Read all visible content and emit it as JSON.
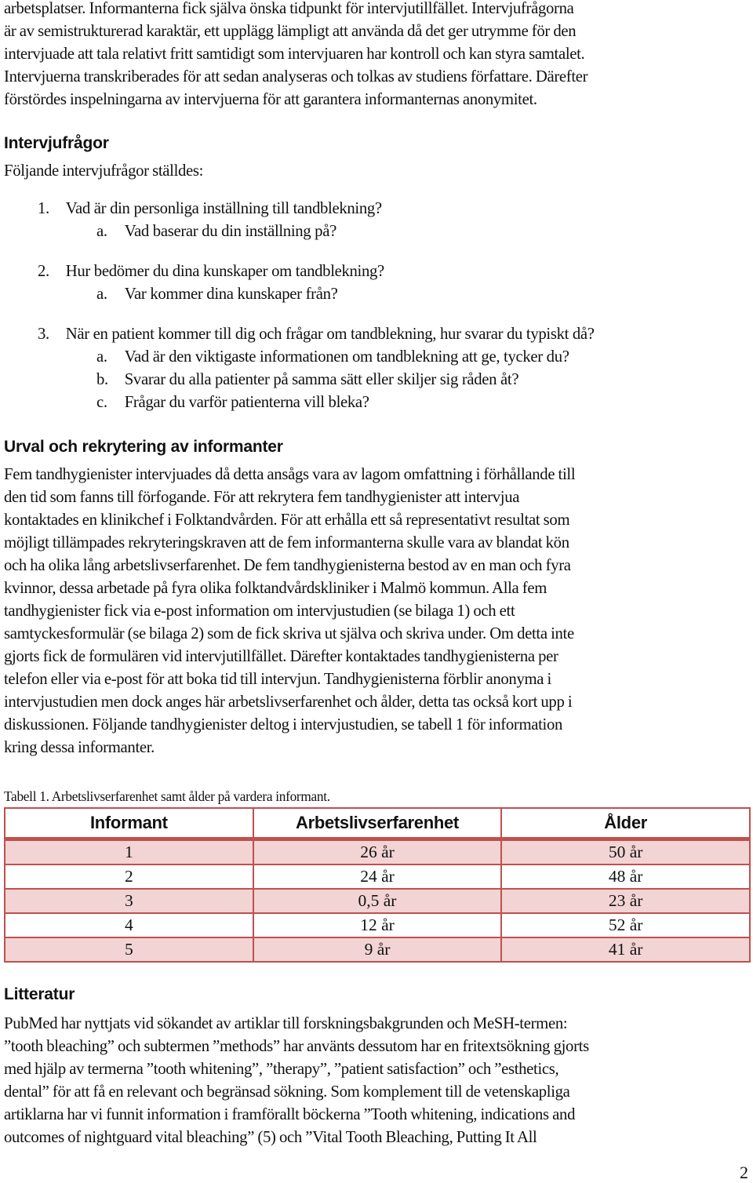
{
  "intro": {
    "lines": [
      "arbetsplatser. Informanterna fick själva önska tidpunkt för intervjutillfället. Intervjufrågorna",
      "är av semistrukturerad karaktär, ett upplägg lämpligt att använda då det ger utrymme för den",
      "intervjuade att tala relativt fritt samtidigt som intervjuaren har kontroll och kan styra samtalet.",
      "Intervjuerna transkriberades för att sedan analyseras och tolkas av studiens författare. Därefter",
      "förstördes inspelningarna av intervjuerna för att garantera informanternas anonymitet."
    ]
  },
  "questions_section": {
    "heading": "Intervjufrågor",
    "lead": "Följande intervjufrågor ställdes:",
    "items": [
      {
        "marker": "1.",
        "text": "Vad är din personliga inställning till tandblekning?",
        "level": 1
      },
      {
        "marker": "a.",
        "text": "Vad baserar du din inställning på?",
        "level": 2
      },
      {
        "marker": "2.",
        "text": "Hur bedömer du dina kunskaper om tandblekning?",
        "level": 1
      },
      {
        "marker": "a.",
        "text": "Var kommer dina kunskaper från?",
        "level": 2
      },
      {
        "marker": "3.",
        "text": "När en patient kommer till dig och frågar om tandblekning, hur svarar du typiskt då?",
        "level": 1
      },
      {
        "marker": "a.",
        "text": "Vad är den viktigaste informationen om tandblekning att ge, tycker du?",
        "level": 2
      },
      {
        "marker": "b.",
        "text": "Svarar du alla patienter på samma sätt eller skiljer sig råden åt?",
        "level": 2
      },
      {
        "marker": "c.",
        "text": "Frågar du varför patienterna vill bleka?",
        "level": 2
      }
    ]
  },
  "selection_section": {
    "heading": "Urval och rekrytering av informanter",
    "lines": [
      "Fem tandhygienister intervjuades då detta ansågs vara av lagom omfattning i förhållande till",
      "den tid som fanns till förfogande. För att rekrytera fem tandhygienister att intervjua",
      "kontaktades en klinikchef i Folktandvården. För att erhålla ett så representativt resultat som",
      "möjligt tillämpades rekryteringskraven att de fem informanterna skulle vara av blandat kön",
      "och ha olika lång arbetslivserfarenhet. De fem tandhygienisterna bestod av en man och fyra",
      "kvinnor, dessa arbetade på fyra olika folktandvårdskliniker i Malmö kommun. Alla fem",
      "tandhygienister fick via e-post information om intervjustudien (se bilaga 1) och ett",
      "samtyckesformulär (se bilaga 2) som de fick skriva ut själva och skriva under. Om detta inte",
      "gjorts fick de formulären vid intervjutillfället. Därefter kontaktades tandhygienisterna per",
      "telefon eller via e-post för att boka tid till intervjun. Tandhygienisterna förblir anonyma i",
      "intervjustudien men dock anges här arbetslivserfarenhet och ålder, detta tas också kort upp i",
      "diskussionen. Följande tandhygienister deltog i intervjustudien, se tabell 1 för information",
      "kring dessa informanter."
    ]
  },
  "table": {
    "caption": "Tabell 1. Arbetslivserfarenhet samt ålder på vardera informant.",
    "headers": [
      "Informant",
      "Arbetslivserfarenhet",
      "Ålder"
    ],
    "rows": [
      [
        "1",
        "26 år",
        "50 år"
      ],
      [
        "2",
        "24 år",
        "48 år"
      ],
      [
        "3",
        "0,5 år",
        "23 år"
      ],
      [
        "4",
        "12 år",
        "52 år"
      ],
      [
        "5",
        "9 år",
        "41 år"
      ]
    ],
    "colors": {
      "border": "#c0504d",
      "band": "#f2d4d4"
    }
  },
  "literature_section": {
    "heading": "Litteratur",
    "lines": [
      "PubMed har nyttjats vid sökandet av artiklar till forskningsbakgrunden och MeSH-termen:",
      "”tooth bleaching” och subtermen ”methods” har använts dessutom har en fritextsökning gjorts",
      "med hjälp av termerna ”tooth whitening”, ”therapy”, ”patient satisfaction” och ”esthetics,",
      "dental” för att få en relevant och begränsad sökning. Som komplement till de vetenskapliga",
      "artiklarna har vi funnit information i framförallt böckerna ”Tooth whitening, indications and",
      "outcomes of nightguard vital bleaching” (5) och ”Vital Tooth Bleaching, Putting It All"
    ]
  },
  "page_number": "2"
}
